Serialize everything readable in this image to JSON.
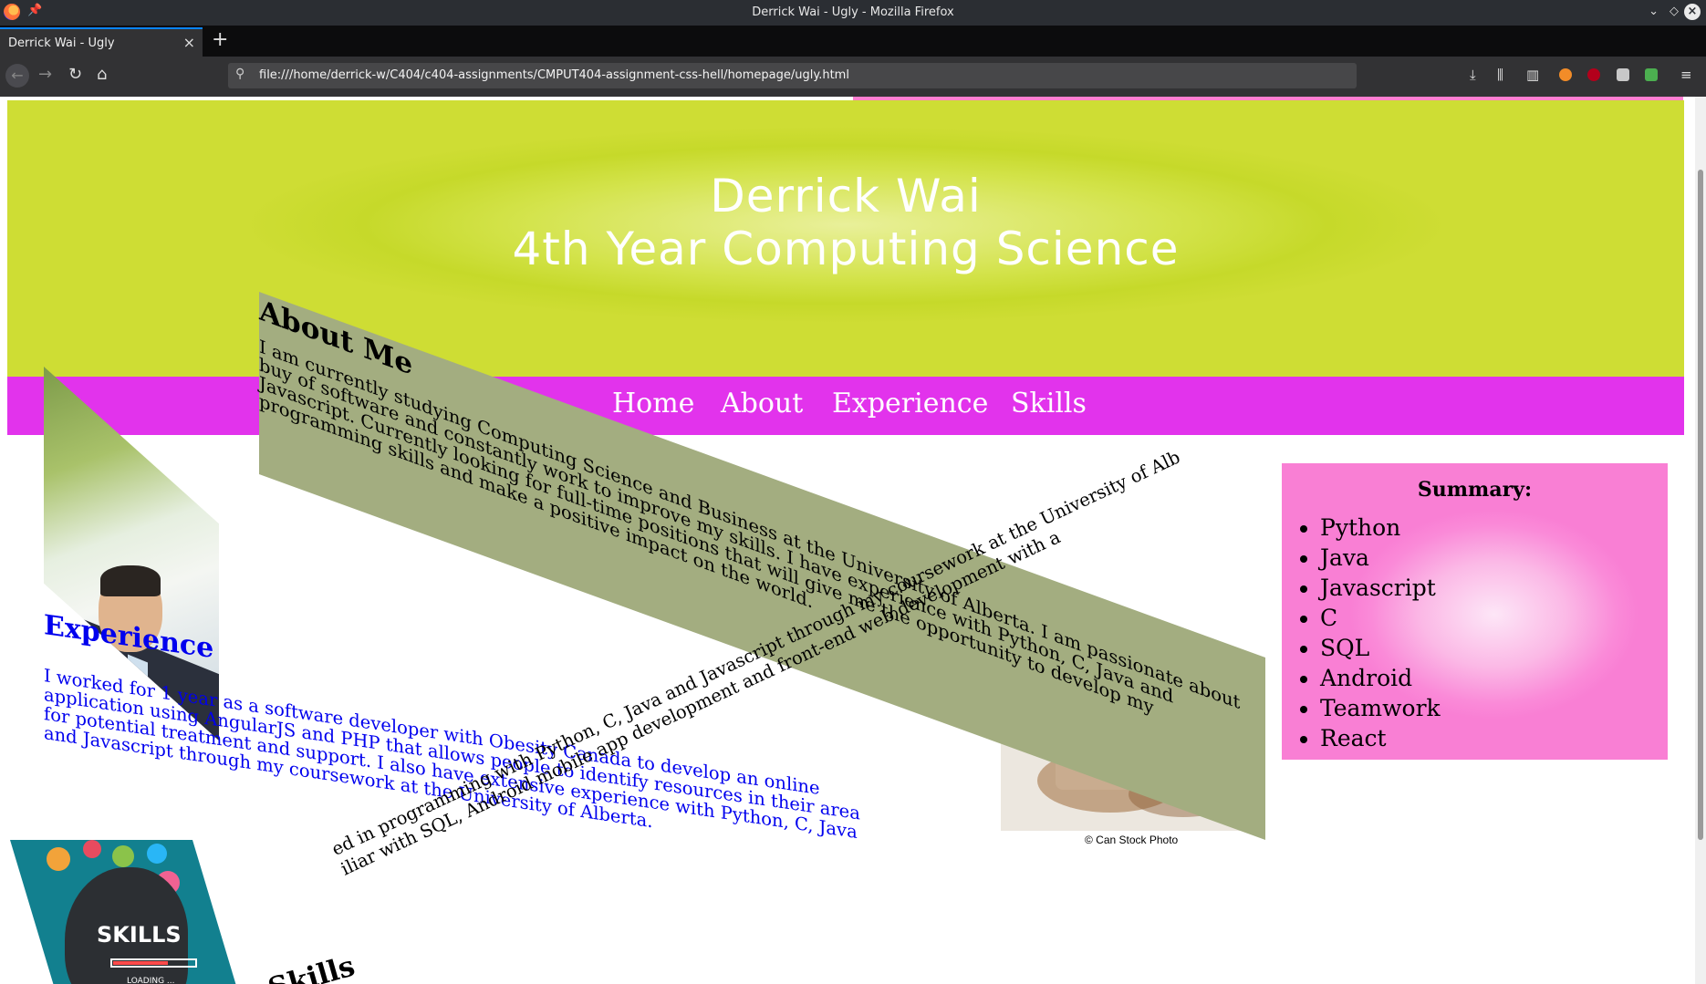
{
  "window": {
    "title": "Derrick Wai - Ugly - Mozilla Firefox"
  },
  "tabs": [
    {
      "label": "Derrick Wai - Ugly"
    }
  ],
  "address_bar": {
    "url": "file:///home/derrick-w/C404/c404-assignments/CMPUT404-assignment-css-hell/homepage/ugly.html"
  },
  "icons": {
    "back": "arrow-left-icon",
    "forward": "arrow-right-icon",
    "reload": "reload-icon",
    "home": "home-icon",
    "search": "search-icon",
    "downloads": "download-icon",
    "library": "library-icon",
    "sidebar": "sidebar-icon",
    "menu": "hamburger-menu-icon"
  },
  "colors": {
    "header_bg": "#cedd34",
    "nav_bg": "#e233ec",
    "about_band": "#a3ad80",
    "summary_bg": "#f97fd4",
    "experience_text": "#0000ee"
  },
  "page": {
    "header": {
      "name": "Derrick Wai",
      "subtitle": "4th Year Computing Science"
    },
    "nav": [
      "Home",
      "About",
      "Experience",
      "Skills"
    ],
    "about": {
      "heading": "About Me",
      "text": "I am currently studying Computing Science and Business at the University of Alberta. I am passionate about buy of software and constantly work to improve my skills. I have experience with Python, C, Java and Javascript. Currently looking for full-time positions that will give me the opportunity to develop my programming skills and make a positive impact on the world."
    },
    "experience": {
      "heading": "Experience",
      "text": "I worked for 1 year as a software developer with Obesity Canada to develop an online application using AngularJS and PHP that allows people to identify resources in their area for potential treatment and support. I also have extensive experience with Python, C, Java and Javascript through my coursework at the University of Alberta."
    },
    "skills": {
      "heading": "Skills",
      "line1": "ed in programming with Python, C, Java and Javascript through my coursework at the University of Alb",
      "line2": "iliar with SQL, Android mobile app development and front-end web development with a",
      "image_word": "SKILLS",
      "image_loading": "LOADING ..."
    },
    "stock_caption": "© Can Stock Photo",
    "summary": {
      "title": "Summary:",
      "items": [
        "Python",
        "Java",
        "Javascript",
        "C",
        "SQL",
        "Android",
        "Teamwork",
        "React"
      ]
    }
  }
}
